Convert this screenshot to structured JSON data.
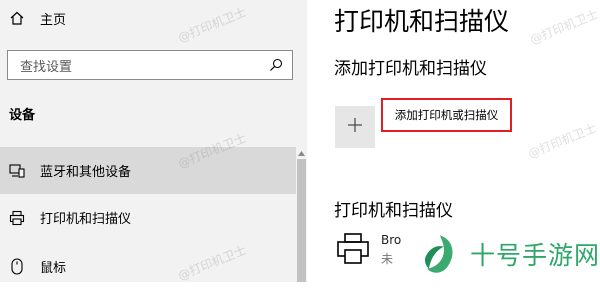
{
  "sidebar": {
    "home_label": "主页",
    "search_placeholder": "查找设置",
    "section_title": "设备",
    "items": [
      {
        "label": "蓝牙和其他设备",
        "icon": "bluetooth-devices-icon"
      },
      {
        "label": "打印机和扫描仪",
        "icon": "printer-icon"
      },
      {
        "label": "鼠标",
        "icon": "mouse-icon"
      }
    ]
  },
  "main": {
    "page_title": "打印机和扫描仪",
    "add_section_title": "添加打印机和扫描仪",
    "add_button_label": "添加打印机或扫描仪",
    "printers_section_title": "打印机和扫描仪",
    "printer": {
      "name": "Bro",
      "status": "未"
    }
  },
  "watermark": {
    "text": "@打印机卫士"
  },
  "brand": {
    "name": "十号手游网"
  },
  "colors": {
    "sidebar_bg": "#f2f2f2",
    "selected_bg": "#d9d9d9",
    "highlight_border": "#e02020",
    "brand": "#2fa66a"
  }
}
